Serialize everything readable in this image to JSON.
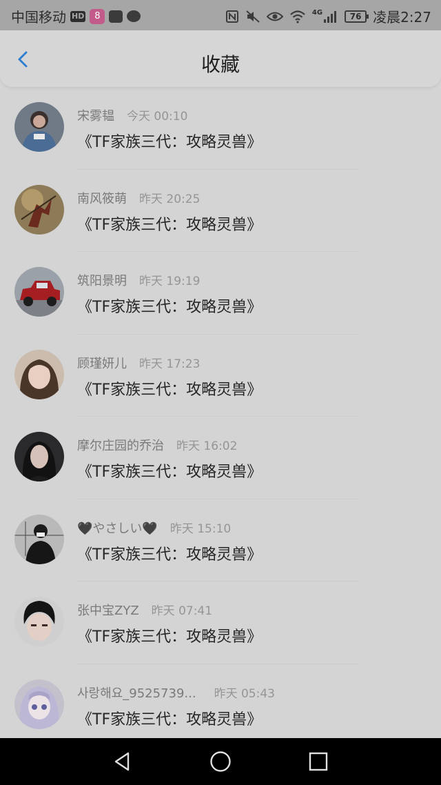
{
  "status_bar": {
    "carrier": "中国移动",
    "hd": "HD",
    "app_badge": "8",
    "network": "4G",
    "battery": "76",
    "time": "凌晨2:27"
  },
  "header": {
    "title": "收藏"
  },
  "favorites": [
    {
      "user": "宋雾韫",
      "time": "今天 00:10",
      "title": "《TF家族三代：攻略灵兽》"
    },
    {
      "user": "南风筱萌",
      "time": "昨天 20:25",
      "title": "《TF家族三代：攻略灵兽》"
    },
    {
      "user": "筑阳景明",
      "time": "昨天 19:19",
      "title": "《TF家族三代：攻略灵兽》"
    },
    {
      "user": "顾瑾妍儿",
      "time": "昨天 17:23",
      "title": "《TF家族三代：攻略灵兽》"
    },
    {
      "user": "摩尔庄园的乔治",
      "time": "昨天 16:02",
      "title": "《TF家族三代：攻略灵兽》"
    },
    {
      "user": "🖤やさしい🖤",
      "time": "昨天 15:10",
      "title": "《TF家族三代：攻略灵兽》"
    },
    {
      "user": "张中宝ZYZ",
      "time": "昨天 07:41",
      "title": "《TF家族三代：攻略灵兽》"
    },
    {
      "user": "사랑해요_9525739...",
      "time": "昨天 05:43",
      "title": "《TF家族三代：攻略灵兽》"
    }
  ],
  "colors": {
    "accent": "#2f7fd0",
    "overlay_background": "#d4d4d4"
  }
}
